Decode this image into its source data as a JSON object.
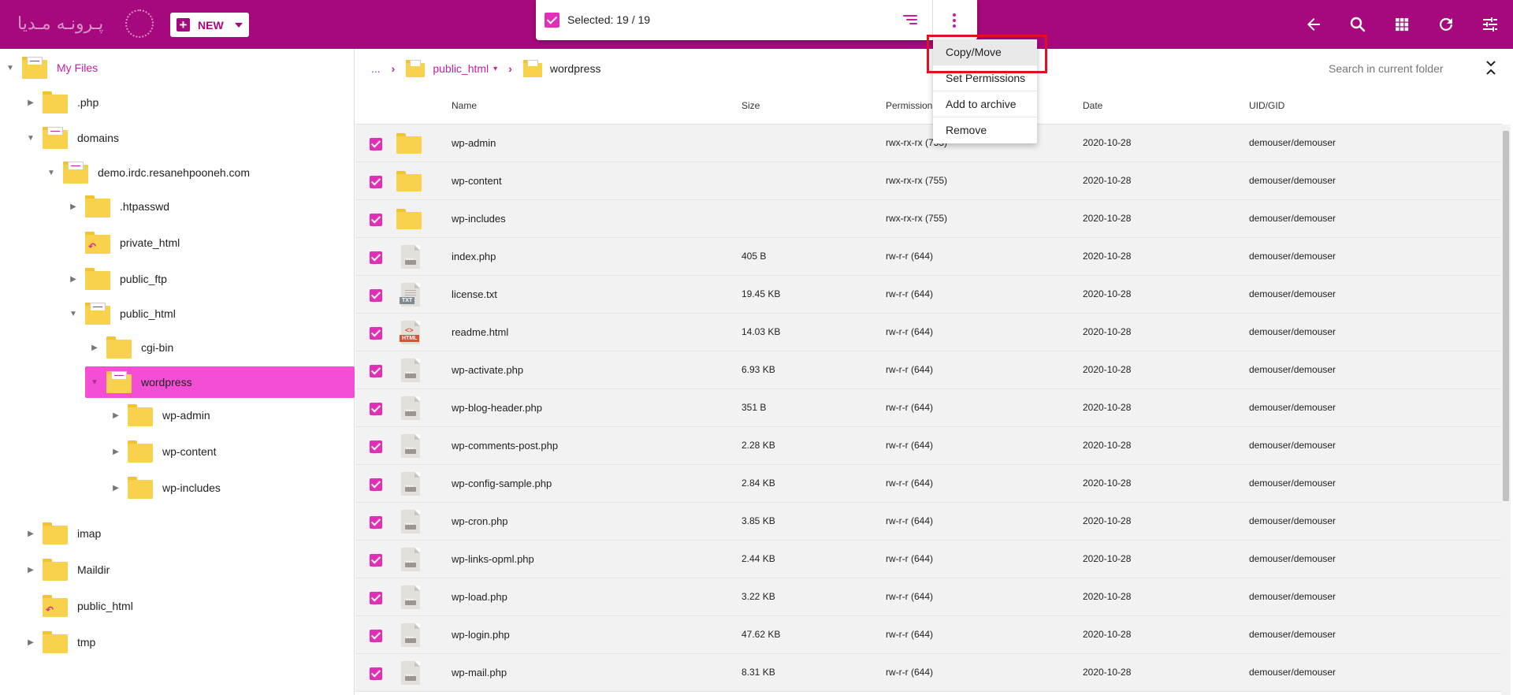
{
  "header": {
    "logo_text": "پـرونـه مـدیا",
    "new_label": "NEW",
    "selected_text": "Selected: 19 / 19",
    "icons": [
      "back-arrow-icon",
      "search-icon",
      "grid-view-icon",
      "refresh-icon",
      "settings-sliders-icon"
    ]
  },
  "menu": {
    "items": [
      "Copy/Move",
      "Set Permissions",
      "Add to archive",
      "Remove"
    ]
  },
  "sidebar": {
    "root": "My Files",
    "nodes": {
      "php": ".php",
      "domains": "domains",
      "demo": "demo.irdc.resanehpooneh.com",
      "htpasswd": ".htpasswd",
      "private_html": "private_html",
      "public_ftp": "public_ftp",
      "public_html": "public_html",
      "cgi_bin": "cgi-bin",
      "wordpress": "wordpress",
      "wp_admin": "wp-admin",
      "wp_content": "wp-content",
      "wp_includes": "wp-includes",
      "imap": "imap",
      "maildir": "Maildir",
      "public_html_root": "public_html",
      "tmp": "tmp"
    }
  },
  "breadcrumb": {
    "dots": "...",
    "parent": "public_html",
    "current": "wordpress"
  },
  "search": {
    "placeholder": "Search in current folder"
  },
  "table": {
    "columns": {
      "name": "Name",
      "size": "Size",
      "permission": "Permission",
      "date": "Date",
      "uid": "UID/GID"
    },
    "rows": [
      {
        "name": "wp-admin",
        "size": "",
        "perm": "rwx-rx-rx (755)",
        "date": "2020-10-28",
        "uid": "demouser/demouser",
        "kind": "folder"
      },
      {
        "name": "wp-content",
        "size": "",
        "perm": "rwx-rx-rx (755)",
        "date": "2020-10-28",
        "uid": "demouser/demouser",
        "kind": "folder"
      },
      {
        "name": "wp-includes",
        "size": "",
        "perm": "rwx-rx-rx (755)",
        "date": "2020-10-28",
        "uid": "demouser/demouser",
        "kind": "folder"
      },
      {
        "name": "index.php",
        "size": "405 B",
        "perm": "rw-r-r (644)",
        "date": "2020-10-28",
        "uid": "demouser/demouser",
        "kind": "php"
      },
      {
        "name": "license.txt",
        "size": "19.45 KB",
        "perm": "rw-r-r (644)",
        "date": "2020-10-28",
        "uid": "demouser/demouser",
        "kind": "txt"
      },
      {
        "name": "readme.html",
        "size": "14.03 KB",
        "perm": "rw-r-r (644)",
        "date": "2020-10-28",
        "uid": "demouser/demouser",
        "kind": "html"
      },
      {
        "name": "wp-activate.php",
        "size": "6.93 KB",
        "perm": "rw-r-r (644)",
        "date": "2020-10-28",
        "uid": "demouser/demouser",
        "kind": "php"
      },
      {
        "name": "wp-blog-header.php",
        "size": "351 B",
        "perm": "rw-r-r (644)",
        "date": "2020-10-28",
        "uid": "demouser/demouser",
        "kind": "php"
      },
      {
        "name": "wp-comments-post.php",
        "size": "2.28 KB",
        "perm": "rw-r-r (644)",
        "date": "2020-10-28",
        "uid": "demouser/demouser",
        "kind": "php"
      },
      {
        "name": "wp-config-sample.php",
        "size": "2.84 KB",
        "perm": "rw-r-r (644)",
        "date": "2020-10-28",
        "uid": "demouser/demouser",
        "kind": "php"
      },
      {
        "name": "wp-cron.php",
        "size": "3.85 KB",
        "perm": "rw-r-r (644)",
        "date": "2020-10-28",
        "uid": "demouser/demouser",
        "kind": "php"
      },
      {
        "name": "wp-links-opml.php",
        "size": "2.44 KB",
        "perm": "rw-r-r (644)",
        "date": "2020-10-28",
        "uid": "demouser/demouser",
        "kind": "php"
      },
      {
        "name": "wp-load.php",
        "size": "3.22 KB",
        "perm": "rw-r-r (644)",
        "date": "2020-10-28",
        "uid": "demouser/demouser",
        "kind": "php"
      },
      {
        "name": "wp-login.php",
        "size": "47.62 KB",
        "perm": "rw-r-r (644)",
        "date": "2020-10-28",
        "uid": "demouser/demouser",
        "kind": "php"
      },
      {
        "name": "wp-mail.php",
        "size": "8.31 KB",
        "perm": "rw-r-r (644)",
        "date": "2020-10-28",
        "uid": "demouser/demouser",
        "kind": "php"
      }
    ]
  },
  "colors": {
    "brand": "#a6097d",
    "accent": "#e12fb6",
    "folder": "#f9d24d",
    "highlight": "#e01020"
  }
}
